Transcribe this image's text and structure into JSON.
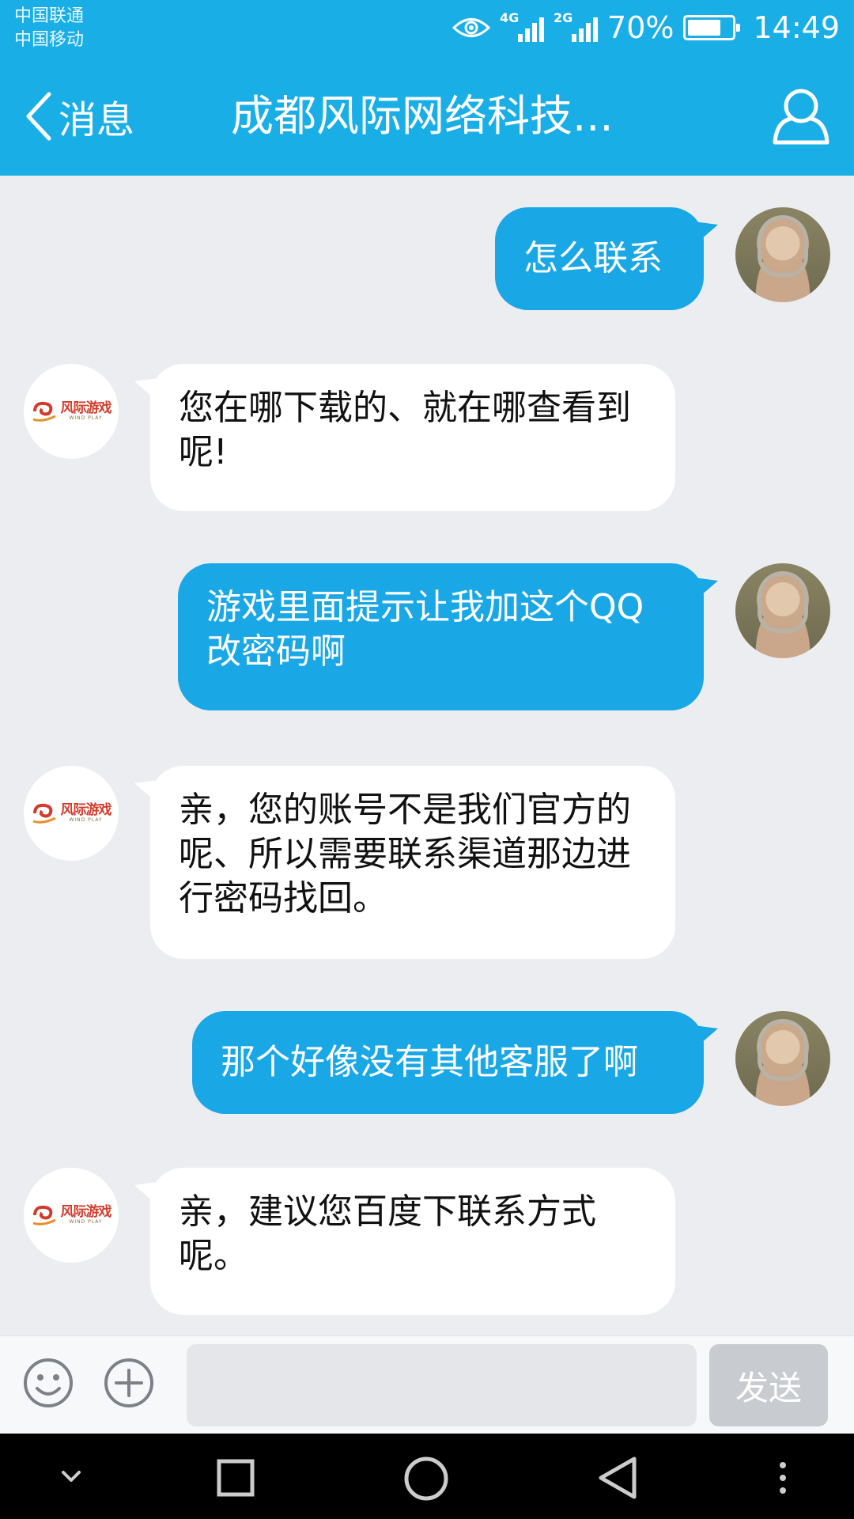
{
  "status_bar": {
    "carrier_1": "中国联通",
    "carrier_2": "中国移动",
    "network_1": "4G",
    "network_2": "2G",
    "battery": "70%",
    "time": "14:49"
  },
  "header": {
    "back_label": "消息",
    "title": "成都风际网络科技...",
    "background_color": "#1aaee6"
  },
  "logo": {
    "text_cn": "风际游戏",
    "text_en": "WIND PLAY"
  },
  "messages": [
    {
      "side": "out",
      "text": "怎么联系"
    },
    {
      "side": "in",
      "text": "您在哪下载的、就在哪查看到呢!"
    },
    {
      "side": "out",
      "text": "游戏里面提示让我加这个QQ改密码啊"
    },
    {
      "side": "in",
      "text": "亲，您的账号不是我们官方的呢、所以需要联系渠道那边进行密码找回。"
    },
    {
      "side": "out",
      "text": "那个好像没有其他客服了啊"
    },
    {
      "side": "in",
      "text": "亲，建议您百度下联系方式呢。"
    }
  ],
  "input_bar": {
    "placeholder": "",
    "send_label": "发送",
    "icons": [
      "smiley-icon",
      "plus-icon"
    ]
  },
  "nav_bar": {
    "icons": [
      "chevron-down-icon",
      "square-icon",
      "circle-icon",
      "back-triangle-icon",
      "more-icon"
    ]
  },
  "colors": {
    "outgoing_bubble": "#1aa7e6",
    "incoming_bubble": "#ffffff",
    "chat_background": "#ebedf0"
  }
}
